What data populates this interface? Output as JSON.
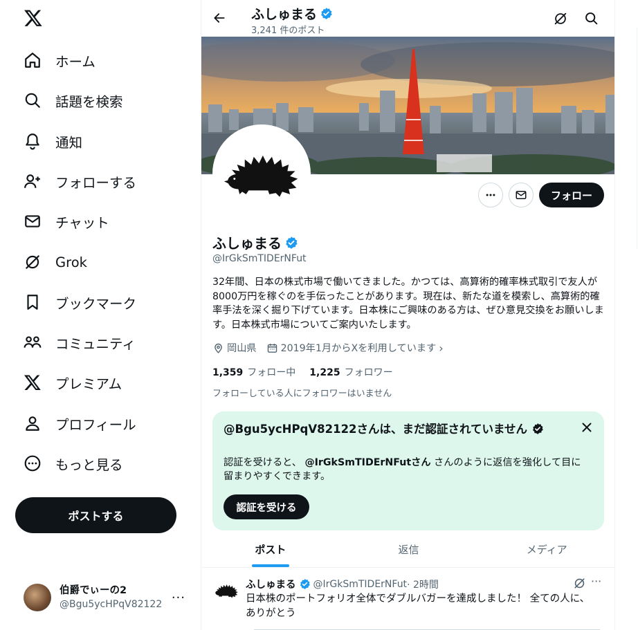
{
  "sidebar": {
    "logo_icon": "x-logo-icon",
    "items": [
      {
        "label": "ホーム",
        "icon": "home-icon"
      },
      {
        "label": "話題を検索",
        "icon": "search-icon"
      },
      {
        "label": "通知",
        "icon": "bell-icon"
      },
      {
        "label": "フォローする",
        "icon": "add-user-icon"
      },
      {
        "label": "チャット",
        "icon": "mail-icon"
      },
      {
        "label": "Grok",
        "icon": "grok-icon"
      },
      {
        "label": "ブックマーク",
        "icon": "bookmark-icon"
      },
      {
        "label": "コミュニティ",
        "icon": "communities-icon"
      },
      {
        "label": "プレミアム",
        "icon": "x-premium-icon"
      },
      {
        "label": "プロフィール",
        "icon": "profile-icon"
      },
      {
        "label": "もっと見る",
        "icon": "more-circle-icon"
      }
    ],
    "post_button": "ポストする",
    "account": {
      "name": "伯爵でぃーの2",
      "handle": "@Bgu5ycHPqV82122",
      "more": "···"
    }
  },
  "header": {
    "name": "ふしゅまる",
    "post_count": "3,241 件のポスト"
  },
  "profile": {
    "name": "ふしゅまる",
    "handle": "@IrGkSmTIDErNFut",
    "bio": "32年間、日本の株式市場で働いてきました。かつては、高算術的確率株式取引で友人が8000万円を稼ぐのを手伝ったことがあります。現在は、新たな道を模索し、高算術的確率手法を深く掘り下げています。日本株にご興味のある方は、ぜひ意見交換をお願いします。日本株式市場についてご案内いたします。",
    "location": "岡山県",
    "joined": "2019年1月からXを利用しています",
    "following_count": "1,359",
    "following_label": "フォロー中",
    "followers_count": "1,225",
    "followers_label": "フォロワー",
    "followers_note": "フォローしている人にフォロワーはいません",
    "follow_button": "フォロー"
  },
  "verify_card": {
    "title": "@Bgu5ycHPqV82122さんは、まだ認証されていません",
    "body_prefix": "認証を受けると、",
    "body_handle": "@IrGkSmTIDErNFutさん",
    "body_suffix": " さんのように返信を強化して目に留まりやすくできます。",
    "button": "認証を受ける"
  },
  "tabs": [
    "ポスト",
    "返信",
    "メディア"
  ],
  "tweet": {
    "name": "ふしゅまる",
    "handle": "@IrGkSmTIDErNFut",
    "time": "· 2時間",
    "text": "日本株のポートフォリオ全体でダブルバガーを達成しました！ 全ての人に、ありがとう",
    "more": "···"
  },
  "colors": {
    "accent": "#1d9bf0",
    "verify_bg": "#def7ec",
    "text_primary": "#0f1419",
    "text_secondary": "#536471"
  }
}
